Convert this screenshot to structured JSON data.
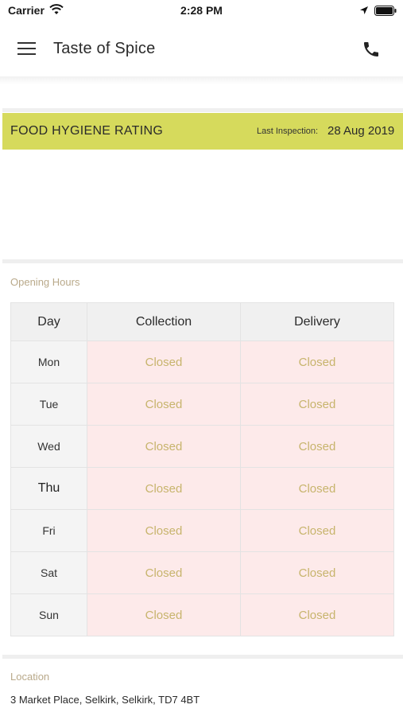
{
  "status_bar": {
    "carrier": "Carrier",
    "time": "2:28 PM"
  },
  "nav": {
    "title": "Taste of Spice"
  },
  "hygiene": {
    "title": "FOOD HYGIENE RATING",
    "last_inspection_label": "Last Inspection:",
    "last_inspection_date": "28 Aug 2019",
    "bar_color": "#d6da5c"
  },
  "opening_hours": {
    "section_label": "Opening Hours",
    "headers": [
      "Day",
      "Collection",
      "Delivery"
    ],
    "rows": [
      {
        "day": "Mon",
        "collection": "Closed",
        "delivery": "Closed"
      },
      {
        "day": "Tue",
        "collection": "Closed",
        "delivery": "Closed"
      },
      {
        "day": "Wed",
        "collection": "Closed",
        "delivery": "Closed"
      },
      {
        "day": "Thu",
        "collection": "Closed",
        "delivery": "Closed"
      },
      {
        "day": "Fri",
        "collection": "Closed",
        "delivery": "Closed"
      },
      {
        "day": "Sat",
        "collection": "Closed",
        "delivery": "Closed"
      },
      {
        "day": "Sun",
        "collection": "Closed",
        "delivery": "Closed"
      }
    ],
    "closed_color": "#c7b46c",
    "closed_bg": "#fdeaea"
  },
  "location": {
    "section_label": "Location",
    "address": "3 Market Place, Selkirk, Selkirk, TD7 4BT"
  },
  "icons": {
    "menu": "menu-icon",
    "phone": "phone-icon",
    "wifi": "wifi-icon",
    "location": "location-arrow-icon",
    "battery": "battery-icon"
  }
}
